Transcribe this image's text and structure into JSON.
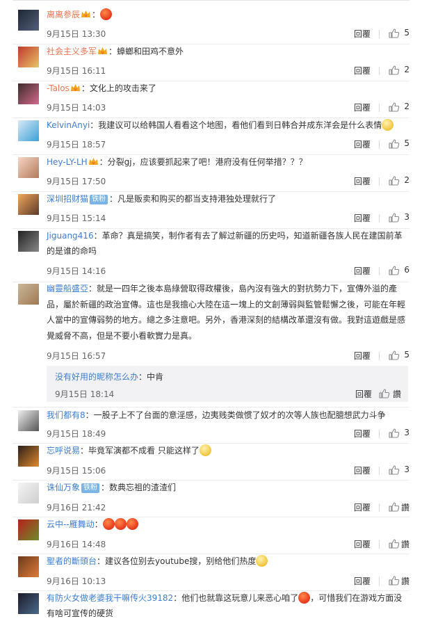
{
  "comments": [
    {
      "user": "离离参辰",
      "user_color": "orange",
      "vip": true,
      "text": "：",
      "emoji": [
        "red-face"
      ],
      "time": "9月15日 13:30",
      "reply": "回覆",
      "likes": "5"
    },
    {
      "user": "社会主义多军",
      "user_color": "orange",
      "vip": true,
      "text": "：蟑螂和田鸡不意外",
      "emoji": [],
      "time": "9月15日 16:11",
      "reply": "回覆",
      "likes": "2"
    },
    {
      "user": "-Talos",
      "user_color": "orange",
      "vip": true,
      "text": "：文化上的攻击来了",
      "emoji": [],
      "time": "9月15日 14:03",
      "reply": "回覆",
      "likes": "2"
    },
    {
      "user": "KelvinAnyi",
      "user_color": "blue",
      "vip": false,
      "text": "：我建议可以给韩国人看看这个地图，看他们看到日韩合并成东洋会是什么表情",
      "emoji": [
        "face"
      ],
      "time": "9月15日 18:57",
      "reply": "回覆",
      "likes": "5"
    },
    {
      "user": "Hey-LY-LH",
      "user_color": "blue",
      "vip": true,
      "text": "：分裂gj，应该要抓起来了吧！港府没有任何举措？？？",
      "emoji": [],
      "time": "9月15日 17:50",
      "reply": "回覆",
      "likes": "2"
    },
    {
      "user": "深圳招财猫",
      "user_color": "blue",
      "vip": false,
      "badge": "铁粉",
      "text": "：凡是贩卖和购买的都当支持港独处理就行了",
      "emoji": [],
      "time": "9月15日 15:14",
      "reply": "回覆",
      "likes": "3"
    },
    {
      "user": "Jiguang416",
      "user_color": "blue",
      "vip": false,
      "text": "：革命？真是搞笑，制作者有去了解过新疆的历史吗，知道新疆各族人民在建国前革的是谁的命吗",
      "emoji": [],
      "time": "9月15日 14:16",
      "reply": "回覆",
      "likes": "6"
    },
    {
      "user": "幽靈船盛亞",
      "user_color": "blue",
      "vip": false,
      "text": "：就是一四年之後本島綠營取得政權後，島內沒有強大的對抗勢力下，宣傳外溢的產品，屬於新疆的政治宣傳。這也是我擔心大陸在這一塊上的文創薄弱與監管鬆懈之後，可能在年輕人當中的宣傳弱勢的地方。總之多注意吧。另外，香港深刻的結構改革還沒有做。我對這遊戲是感覺威脅不高，但是不要小看軟實力是真。",
      "emoji": [],
      "time": "9月15日 16:57",
      "reply": "回覆",
      "likes": "5"
    },
    {
      "user": "我们都有8",
      "user_color": "blue",
      "vip": false,
      "text": "：一股子上不了台面的意淫感，边夷贱类做惯了奴才的次等人族也配臆想武力斗争",
      "emoji": [],
      "time": "9月15日 18:49",
      "reply": "回覆",
      "likes": "3"
    },
    {
      "user": "忘呼说易",
      "user_color": "blue",
      "vip": false,
      "text": "：毕竟军演都不成看 只能这样了",
      "emoji": [
        "face"
      ],
      "time": "9月15日 15:06",
      "reply": "回覆",
      "likes": "3"
    },
    {
      "user": "诛仙万象",
      "user_color": "blue",
      "vip": false,
      "badge": "铁粉",
      "text": "：数典忘祖的渣渣们",
      "emoji": [],
      "time": "9月16日 21:42",
      "reply": "回覆",
      "likes": "讚"
    },
    {
      "user": "云中--雁舞动",
      "user_color": "blue",
      "vip": false,
      "text": "：",
      "emoji": [
        "red-face",
        "red-face",
        "red-face"
      ],
      "time": "9月16日 14:48",
      "reply": "回覆",
      "likes": "讚"
    },
    {
      "user": "聖者的斷頭台",
      "user_color": "blue",
      "vip": false,
      "text": "：建议各位别去youtube搜，别给他们热度",
      "emoji": [
        "face"
      ],
      "time": "9月16日 10:13",
      "reply": "回覆",
      "likes": "讚"
    },
    {
      "user": "有防火女做老婆我干嘛传火39182",
      "user_color": "blue",
      "vip": false,
      "text": "：他们也就靠这玩意儿来恶心咱了",
      "text2": "，可惜我们在游戏方面没有啥可宣传的硬货",
      "emoji": [
        "red-face"
      ],
      "time": "",
      "reply": "",
      "likes": ""
    }
  ],
  "nested_reply": {
    "user": "没有好用的昵称怎么办",
    "text": "：中肯",
    "time": "9月15日 18:14",
    "reply": "回覆",
    "likes": "讚"
  }
}
